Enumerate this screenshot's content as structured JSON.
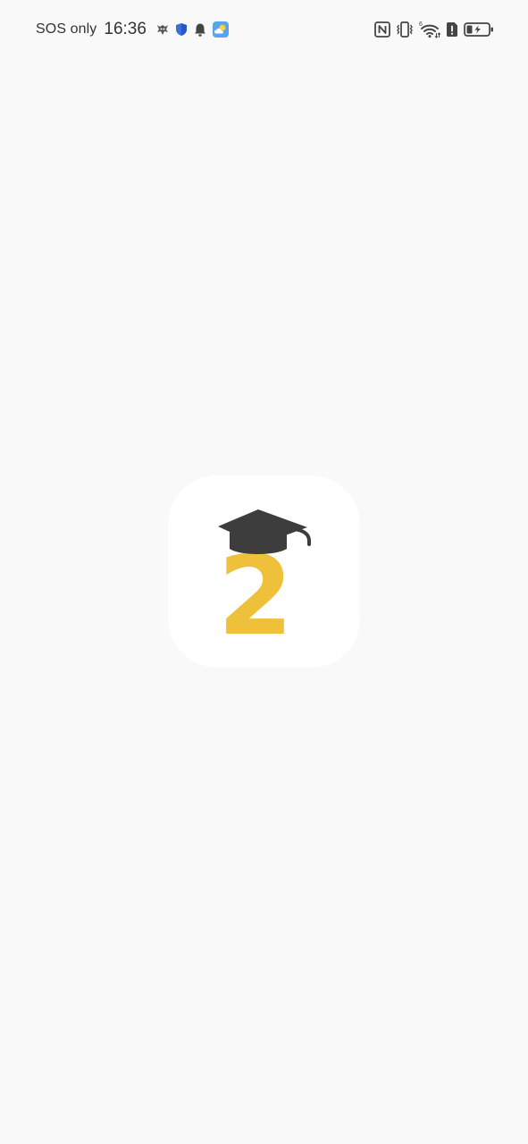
{
  "status_bar": {
    "carrier": "SOS only",
    "time": "16:36",
    "left_icons": [
      "app-dragon-icon",
      "shield-icon",
      "bell-icon",
      "weather-icon"
    ],
    "right_icons": [
      "nfc-icon",
      "vibrate-icon",
      "wifi-icon",
      "sim-alert-icon",
      "battery-charging-icon"
    ]
  },
  "splash": {
    "logo_text": "2",
    "icon": "graduation-cap-icon"
  },
  "colors": {
    "background": "#f9f9f9",
    "tile": "#ffffff",
    "logo_yellow": "#efc13b",
    "cap_dark": "#3d3d3d",
    "status_text": "#333333"
  }
}
